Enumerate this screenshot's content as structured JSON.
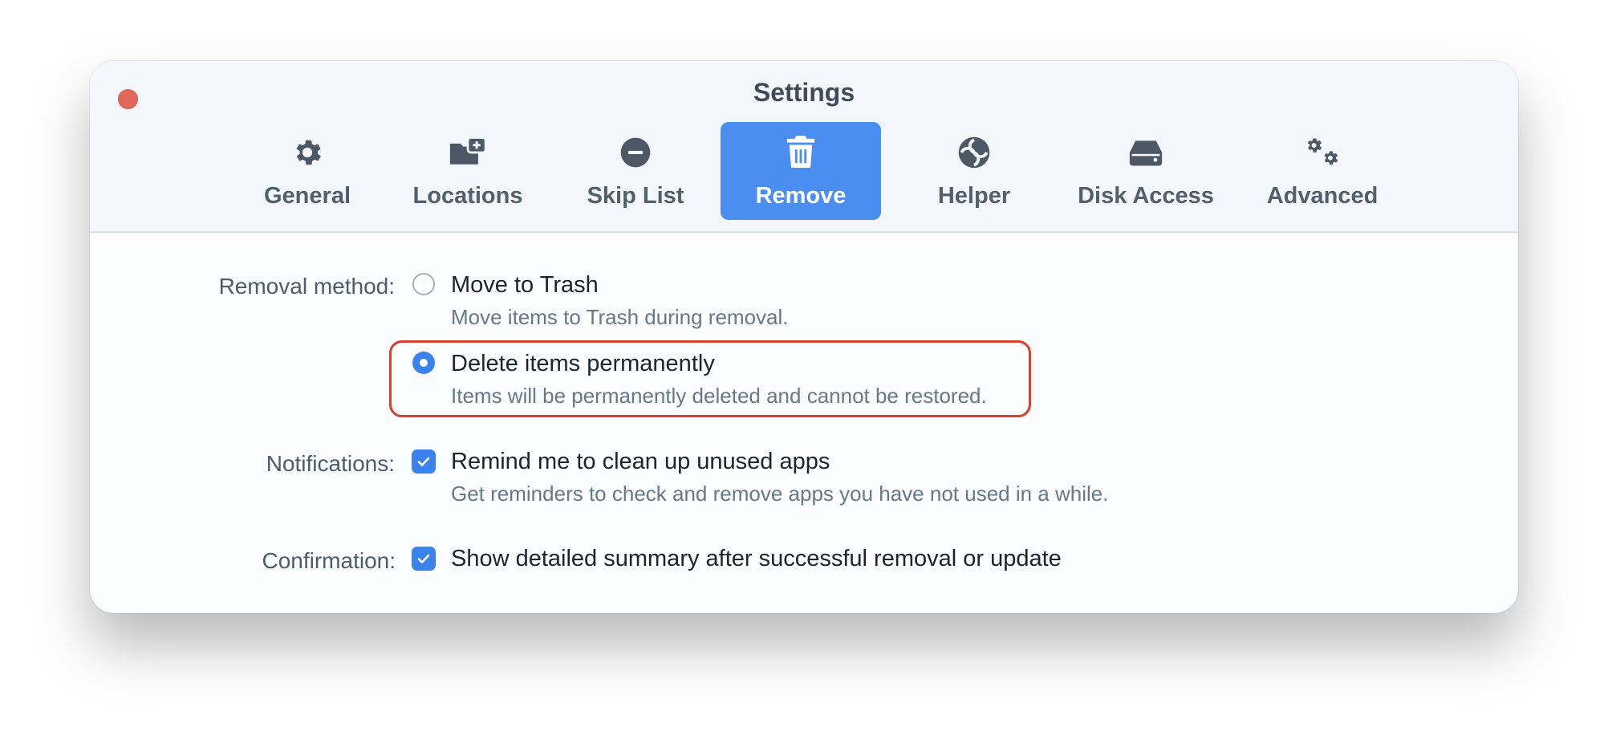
{
  "window": {
    "title": "Settings"
  },
  "tabs": [
    {
      "label": "General",
      "icon": "gear-icon",
      "active": false
    },
    {
      "label": "Locations",
      "icon": "folder-add-icon",
      "active": false
    },
    {
      "label": "Skip List",
      "icon": "minus-circle-icon",
      "active": false
    },
    {
      "label": "Remove",
      "icon": "trash-icon",
      "active": true
    },
    {
      "label": "Helper",
      "icon": "helper-icon",
      "active": false
    },
    {
      "label": "Disk Access",
      "icon": "hard-drive-icon",
      "active": false
    },
    {
      "label": "Advanced",
      "icon": "gears-icon",
      "active": false
    }
  ],
  "removal": {
    "label": "Removal method:",
    "options": [
      {
        "title": "Move to Trash",
        "description": "Move items to Trash during removal.",
        "selected": false
      },
      {
        "title": "Delete items permanently",
        "description": "Items will be permanently deleted and cannot be restored.",
        "selected": true
      }
    ]
  },
  "notifications": {
    "label": "Notifications:",
    "title": "Remind me to clean up unused apps",
    "description": "Get reminders to check and remove apps you have not used in a while.",
    "checked": true
  },
  "confirmation": {
    "label": "Confirmation:",
    "title": "Show detailed summary after successful removal or update",
    "checked": true
  },
  "colors": {
    "accent": "#4a8ef0",
    "highlight": "#d9402f",
    "close": "#e0675a"
  }
}
